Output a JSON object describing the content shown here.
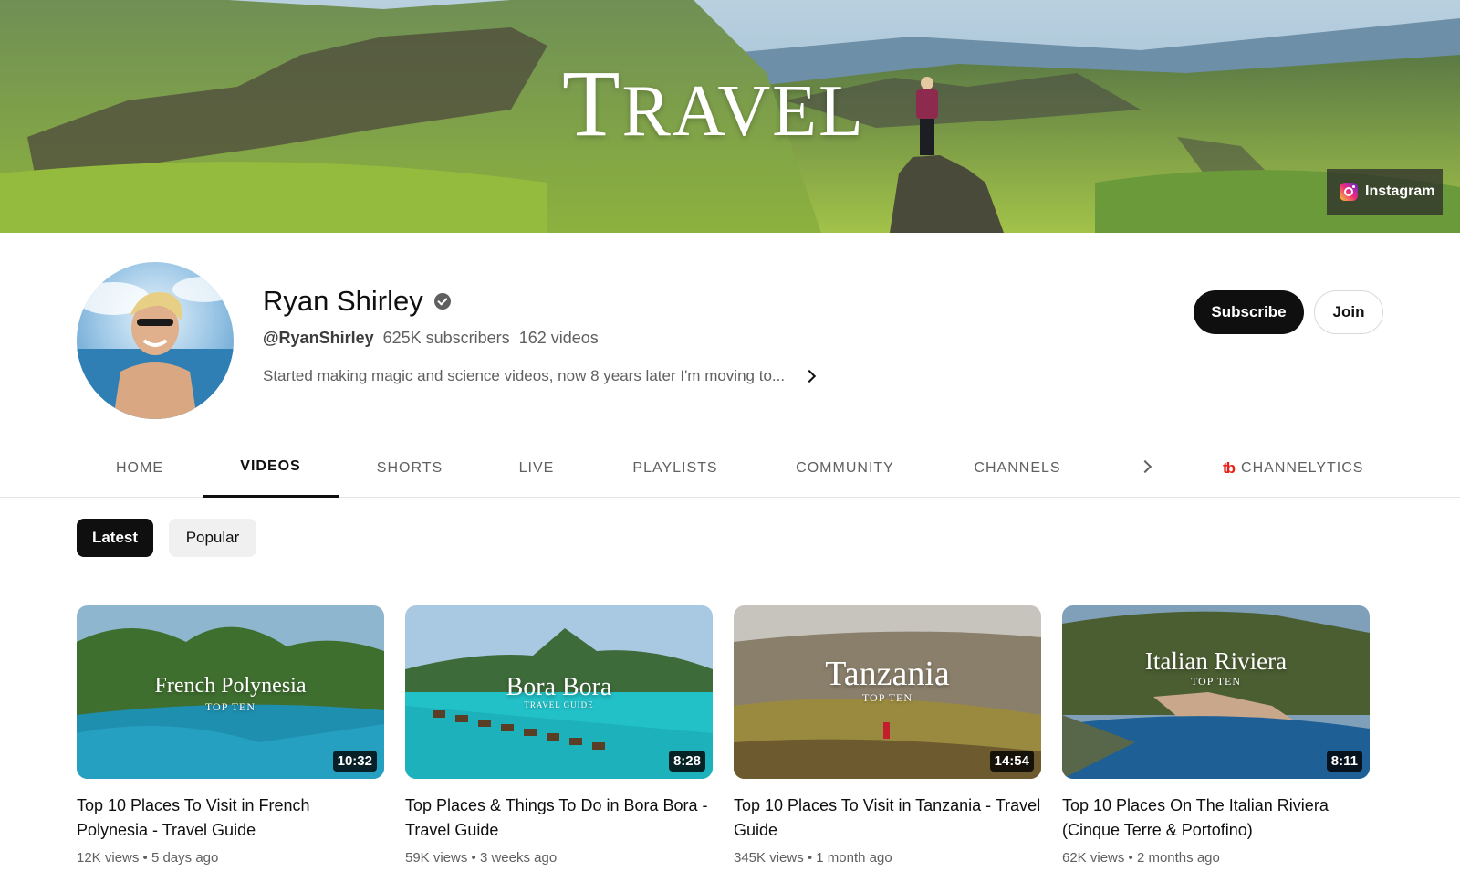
{
  "banner": {
    "title_initial": "T",
    "title_rest": "RAVEL",
    "link_label": "Instagram",
    "link_icon": "instagram-icon"
  },
  "channel": {
    "name": "Ryan Shirley",
    "handle": "@RyanShirley",
    "subscribers": "625K subscribers",
    "videos": "162 videos",
    "description": "Started making magic and science videos, now 8 years later I'm moving to..."
  },
  "actions": {
    "subscribe_label": "Subscribe",
    "join_label": "Join"
  },
  "tabs": [
    {
      "label": "HOME"
    },
    {
      "label": "VIDEOS",
      "active": true
    },
    {
      "label": "SHORTS"
    },
    {
      "label": "LIVE"
    },
    {
      "label": "PLAYLISTS"
    },
    {
      "label": "COMMUNITY"
    },
    {
      "label": "CHANNELS"
    }
  ],
  "extension_tab": {
    "icon_text": "tb",
    "label": "CHANNELYTICS"
  },
  "chips": {
    "latest": "Latest",
    "popular": "Popular"
  },
  "videos": [
    {
      "thumb_title": "French Polynesia",
      "thumb_sub": "TOP TEN",
      "duration": "10:32",
      "title": "Top 10 Places To Visit in French Polynesia - Travel Guide",
      "meta": "12K views • 5 days ago"
    },
    {
      "thumb_title": "Bora Bora",
      "thumb_sub": "TRAVEL GUIDE",
      "duration": "8:28",
      "title": "Top Places & Things To Do in Bora Bora - Travel Guide",
      "meta": "59K views • 3 weeks ago"
    },
    {
      "thumb_title": "Tanzania",
      "thumb_sub": "TOP TEN",
      "duration": "14:54",
      "title": "Top 10 Places To Visit in Tanzania - Travel Guide",
      "meta": "345K views • 1 month ago"
    },
    {
      "thumb_title": "Italian Riviera",
      "thumb_sub": "TOP TEN",
      "duration": "8:11",
      "title": "Top 10 Places On The Italian Riviera (Cinque Terre & Portofino)",
      "meta": "62K views • 2 months ago"
    }
  ],
  "colors": {
    "brand_red": "#e62117",
    "text_primary": "#0f0f0f",
    "text_secondary": "#606060"
  }
}
